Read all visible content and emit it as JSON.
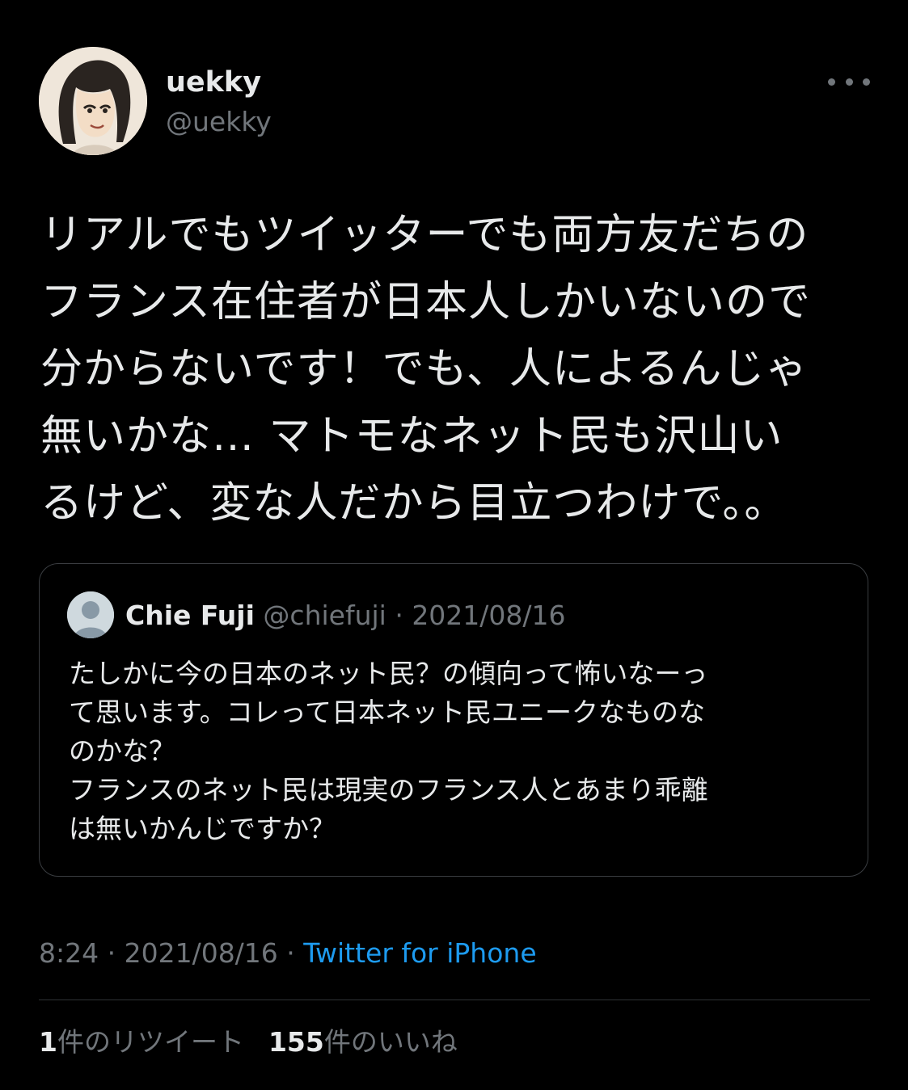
{
  "author": {
    "name": "uekky",
    "handle": "@uekky"
  },
  "more_icon": "more-horizontal-icon",
  "tweet": {
    "text": "リアルでもツイッターでも両方友だちの\nフランス在住者が日本人しかいないので\n分からないです！でも、人によるんじゃ\n無いかな… マトモなネット民も沢山い\nるけど、変な人だから目立つわけで。。"
  },
  "quote": {
    "name": "Chie Fuji",
    "handle": "@chiefuji",
    "separator": " · ",
    "date": "2021/08/16",
    "text": "たしかに今の日本のネット民？の傾向って怖いなーっ\nて思います。コレって日本ネット民ユニークなものな\nのかな？\nフランスのネット民は現実のフランス人とあまり乖離\nは無いかんじですか？"
  },
  "meta": {
    "time": "8:24",
    "separator": " · ",
    "date": "2021/08/16",
    "source": "Twitter for iPhone"
  },
  "stats": {
    "retweet_count": "1",
    "retweet_label": "件のリツイート",
    "like_count": "155",
    "like_label": "件のいいね"
  },
  "colors": {
    "background": "#000000",
    "text": "#e7e9ea",
    "secondary": "#71767b",
    "link": "#1d9bf0",
    "border": "#2f3336"
  }
}
